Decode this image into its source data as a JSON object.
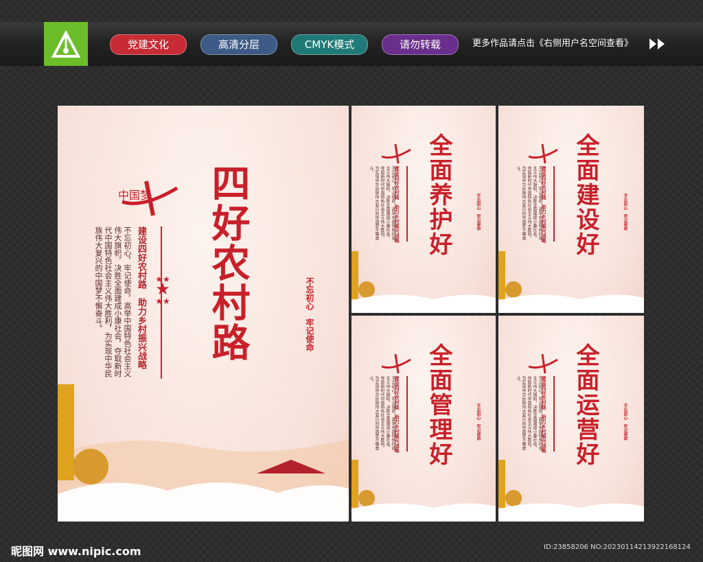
{
  "toolbar": {
    "tags": [
      {
        "label": "党建文化",
        "color": "#c72b35"
      },
      {
        "label": "高清分层",
        "color": "#3e5a86"
      },
      {
        "label": "CMYK模式",
        "color": "#1f7a77"
      },
      {
        "label": "请勿转载",
        "color": "#6a2f8c"
      }
    ],
    "promo_text": "更多作品请点击《右侧用户名空间查看》"
  },
  "main_poster": {
    "title": "四好农村路",
    "subtitle": "建设四好农村路　助力乡村振兴战略",
    "body": "不忘初心，牢记使命，高举中国特色社会主义伟大旗帜，决胜全面建成小康社会，夺取新时代中国特色社会主义伟大胜利，为实现中华民族伟大复兴的中国梦不懈奋斗。",
    "motto": "不忘初心　牢记使命",
    "logo_text": "中国梦"
  },
  "small_posters": [
    {
      "title": "全面养护好",
      "subtitle": "建设四好农村路　助力乡村振兴战略",
      "motto": "不忘初心　牢记使命"
    },
    {
      "title": "全面建设好",
      "subtitle": "建设四好农村路　助力乡村振兴战略",
      "motto": "不忘初心　牢记使命"
    },
    {
      "title": "全面管理好",
      "subtitle": "建设四好农村路　助力乡村振兴战略",
      "motto": "不忘初心　牢记使命"
    },
    {
      "title": "全面运营好",
      "subtitle": "建设四好农村路　助力乡村振兴战略",
      "motto": "不忘初心　牢记使命"
    }
  ],
  "small_body": "不忘初心，牢记使命，高举中国特色社会主义伟大旗帜，决胜全面建成小康社会，夺取新时代中国特色社会主义伟大胜利，为实现中华民族伟大复兴的中国梦不懈奋斗。",
  "footer": {
    "site": "昵图网 www.nipic.com",
    "id_text": "ID:23858206 NO:20230114213922168124"
  },
  "colors": {
    "accent": "#c8202a",
    "logo_green": "#6bbd2a"
  }
}
